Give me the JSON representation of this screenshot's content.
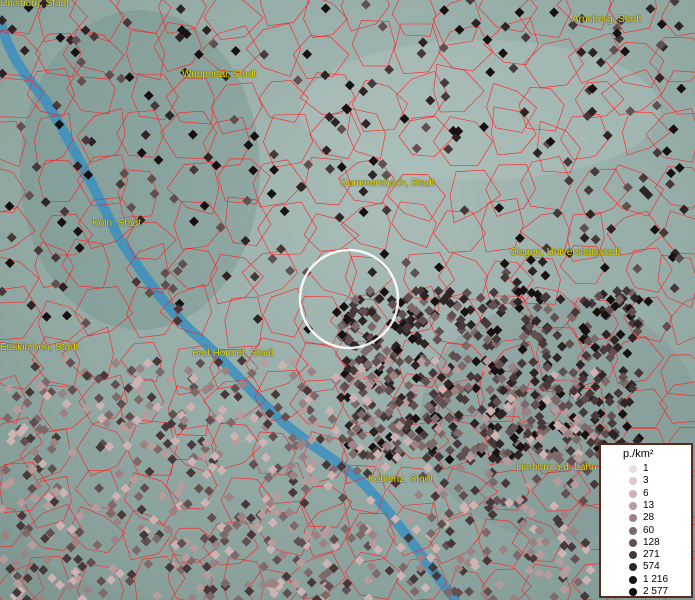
{
  "cities": [
    {
      "name": "Duisburg, Stadt"
    },
    {
      "name": "Arnsberg, Stadt"
    },
    {
      "name": "Wuppertal, Stadt"
    },
    {
      "name": "Gummersbach, Stadt"
    },
    {
      "name": "Köln, Stadt"
    },
    {
      "name": "Siegen, Universitätsstadt"
    },
    {
      "name": "Euskirchen, Stadt"
    },
    {
      "name": "Bad Honnef, Stadt"
    },
    {
      "name": "Limburg a.d. Lahn"
    },
    {
      "name": "Koblenz, Stadt"
    }
  ],
  "legend": {
    "title": "p./km²",
    "entries": [
      {
        "label": "1",
        "color": "#eddede"
      },
      {
        "label": "3",
        "color": "#dfc9c9"
      },
      {
        "label": "6",
        "color": "#cfb3b3"
      },
      {
        "label": "13",
        "color": "#b79c9c"
      },
      {
        "label": "28",
        "color": "#9c8282"
      },
      {
        "label": "60",
        "color": "#7e6969"
      },
      {
        "label": "128",
        "color": "#625050"
      },
      {
        "label": "271",
        "color": "#473939"
      },
      {
        "label": "574",
        "color": "#2e2424"
      },
      {
        "label": "1 216",
        "color": "#171111"
      },
      {
        "label": "2 577",
        "color": "#000000"
      }
    ]
  },
  "colors": {
    "river": "#3a8fc0",
    "borders": "#ff2020",
    "labels": "#e8e000"
  }
}
